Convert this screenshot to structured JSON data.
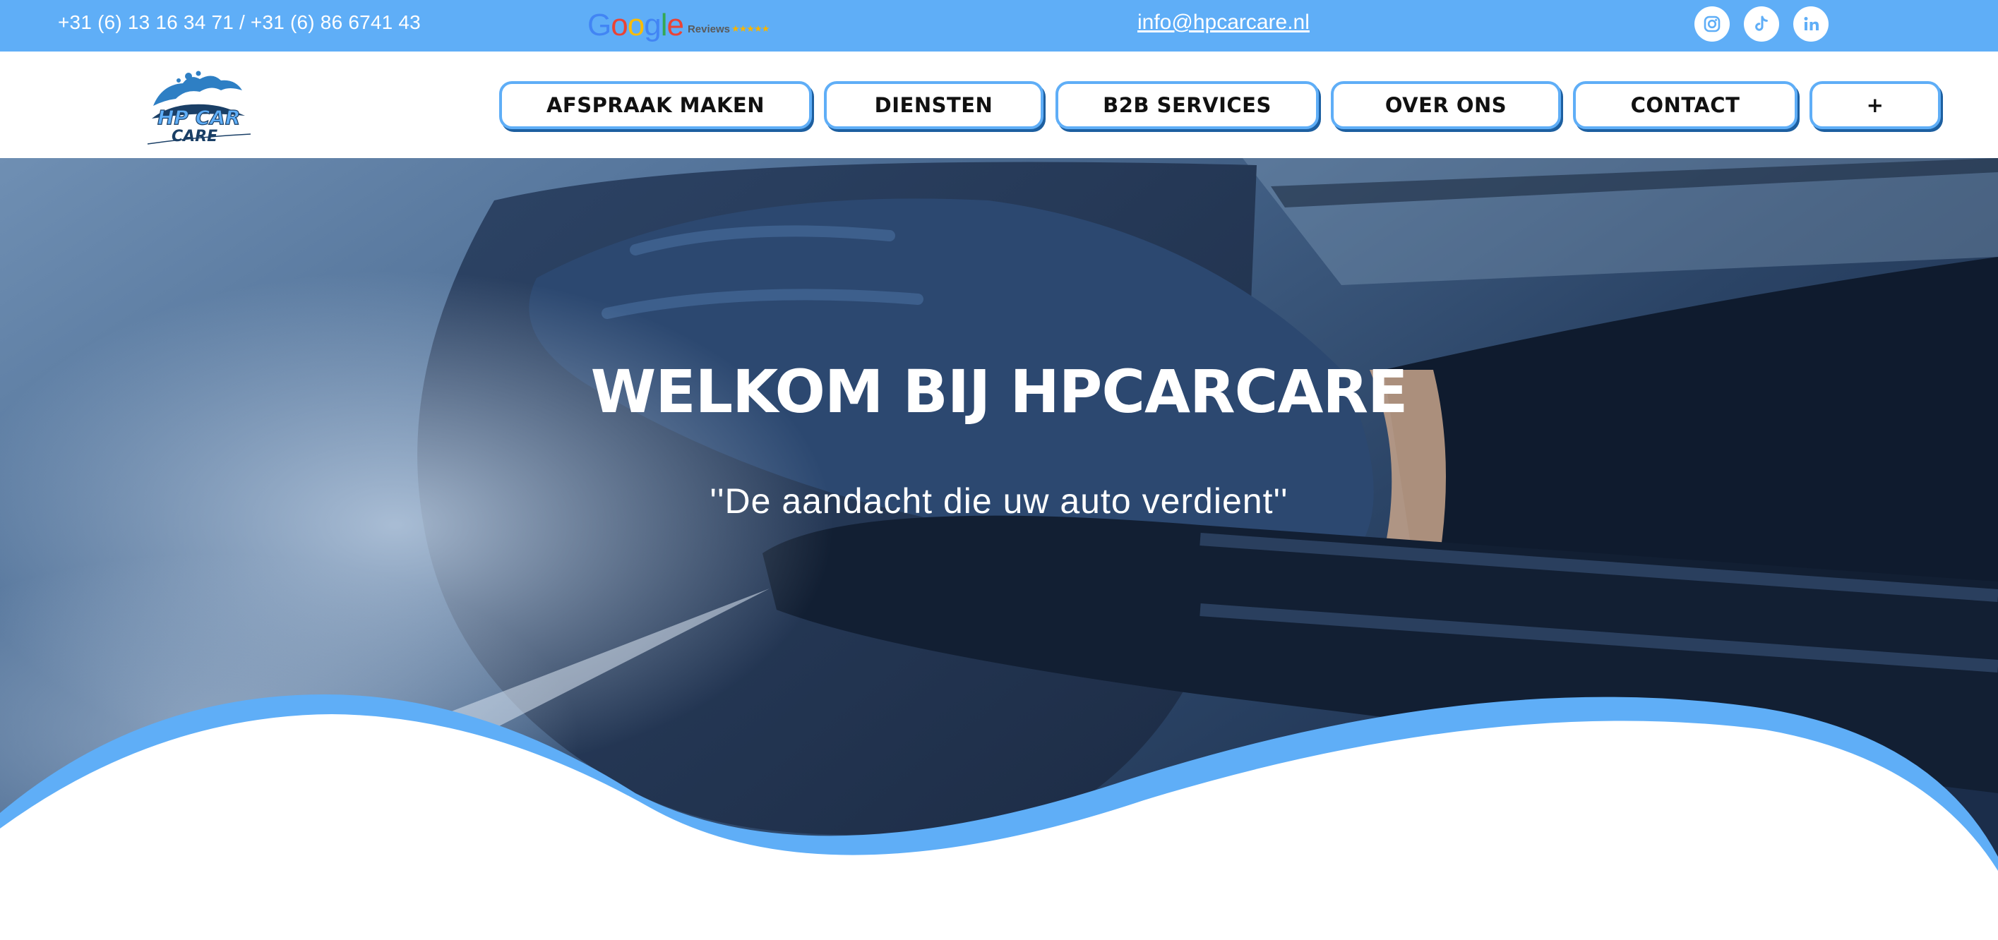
{
  "topbar": {
    "phones": "+31 (6) 13 16 34 71 / +31 (6) 86 6741 43",
    "google": {
      "letters": [
        "G",
        "o",
        "o",
        "g",
        "l",
        "e"
      ],
      "reviews": "Reviews",
      "stars": "★★★★★"
    },
    "email": "info@hpcarcare.nl",
    "social": [
      {
        "name": "instagram-icon"
      },
      {
        "name": "tiktok-icon"
      },
      {
        "name": "linkedin-icon"
      }
    ]
  },
  "logo": {
    "line1": "HP CAR",
    "line2": "CARE"
  },
  "nav": {
    "items": [
      {
        "label": "AFSPRAAK MAKEN"
      },
      {
        "label": "DIENSTEN"
      },
      {
        "label": "B2B SERVICES"
      },
      {
        "label": "OVER ONS"
      },
      {
        "label": "CONTACT"
      },
      {
        "label": "+"
      }
    ]
  },
  "hero": {
    "title": "WELKOM BIJ HPCARCARE",
    "subtitle": "''De aandacht die uw auto verdient''"
  },
  "colors": {
    "accent": "#5FAEF7",
    "hero_dark": "#1b2d4a",
    "hero_light": "#6f8fb3",
    "google_blue": "#4285F4",
    "google_red": "#EA4335",
    "google_yellow": "#FBBC05",
    "google_green": "#34A853"
  }
}
